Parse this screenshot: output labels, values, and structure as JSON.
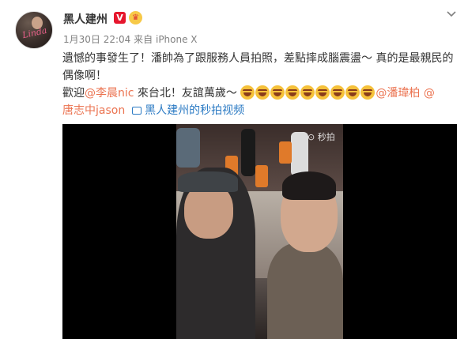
{
  "post": {
    "username": "黑人建州",
    "verified_badge": "V",
    "meta": {
      "time": "1月30日 22:04",
      "source_prefix": "来自",
      "device": "iPhone X"
    },
    "content": {
      "line1": "遺憾的事發生了！潘帥為了跟服務人員拍照，差點摔成腦震盪～ 真的是最親民的",
      "line2": "偶像啊！",
      "line3_prefix": "歡迎",
      "mention_1": "@李晨nic",
      "line3_mid": " 來台北！友誼萬歲～ ",
      "mention_2": "@潘瑋柏",
      "mention_3": "@",
      "mention_3b": "唐志中jason",
      "video_link": "黑人建州的秒拍视频"
    },
    "emoji_count": 9,
    "video": {
      "watermark": "秒拍"
    },
    "icons": {
      "menu": "chevron-down-icon",
      "verified": "verified-v-icon",
      "member": "member-crown-icon",
      "video": "video-link-icon"
    },
    "colors": {
      "mention": "#eb7350",
      "link": "#2c7bc4",
      "verified": "#e6162d"
    }
  }
}
